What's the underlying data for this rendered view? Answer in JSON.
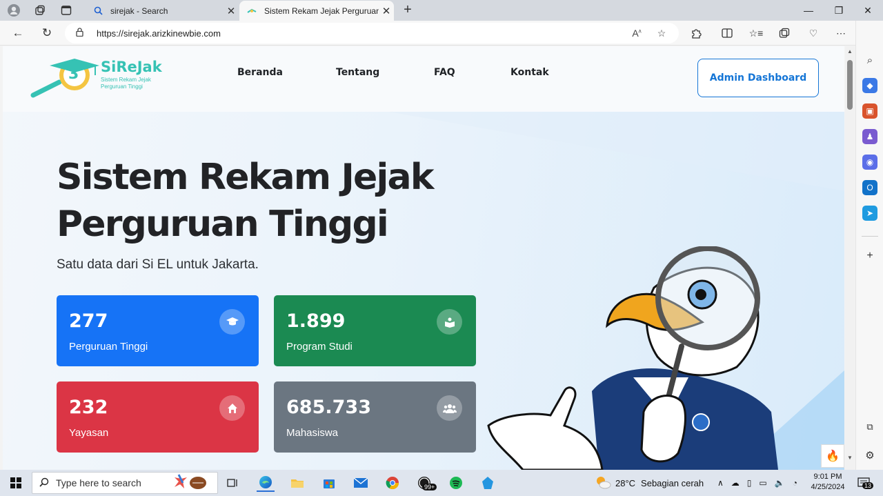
{
  "browser": {
    "tabs": [
      {
        "title": "sirejak - Search",
        "active": false,
        "favicon": "search-icon"
      },
      {
        "title": "Sistem Rekam Jejak Perguruan Tinggi",
        "active": true,
        "favicon": "sirejak-favicon"
      }
    ],
    "url": "https://sirejak.arizkinewbie.com"
  },
  "site": {
    "logo": {
      "title": "SiReJak",
      "subtitle": "Sistem Rekam Jejak Perguruan Tinggi",
      "mark": "3"
    },
    "nav": [
      "Beranda",
      "Tentang",
      "FAQ",
      "Kontak"
    ],
    "admin_button": "Admin Dashboard",
    "hero": {
      "title_line1": "Sistem Rekam Jejak",
      "title_line2": "Perguruan Tinggi",
      "subtitle": "Satu data dari Si EL untuk Jakarta."
    },
    "stats": [
      {
        "value": "277",
        "label": "Perguruan Tinggi",
        "color": "#1673f6",
        "icon": "graduation-cap-icon"
      },
      {
        "value": "1.899",
        "label": "Program Studi",
        "color": "#1b8a52",
        "icon": "book-icon"
      },
      {
        "value": "232",
        "label": "Yayasan",
        "color": "#db3545",
        "icon": "home-icon"
      },
      {
        "value": "685.733",
        "label": "Mahasiswa",
        "color": "#6b7681",
        "icon": "users-icon"
      }
    ]
  },
  "taskbar": {
    "search_placeholder": "Type here to search",
    "weather_temp": "28°C",
    "weather_desc": "Sebagian cerah",
    "time": "9:01 PM",
    "date": "4/25/2024",
    "notification_count": "13",
    "whatsapp_badge": "99+"
  }
}
